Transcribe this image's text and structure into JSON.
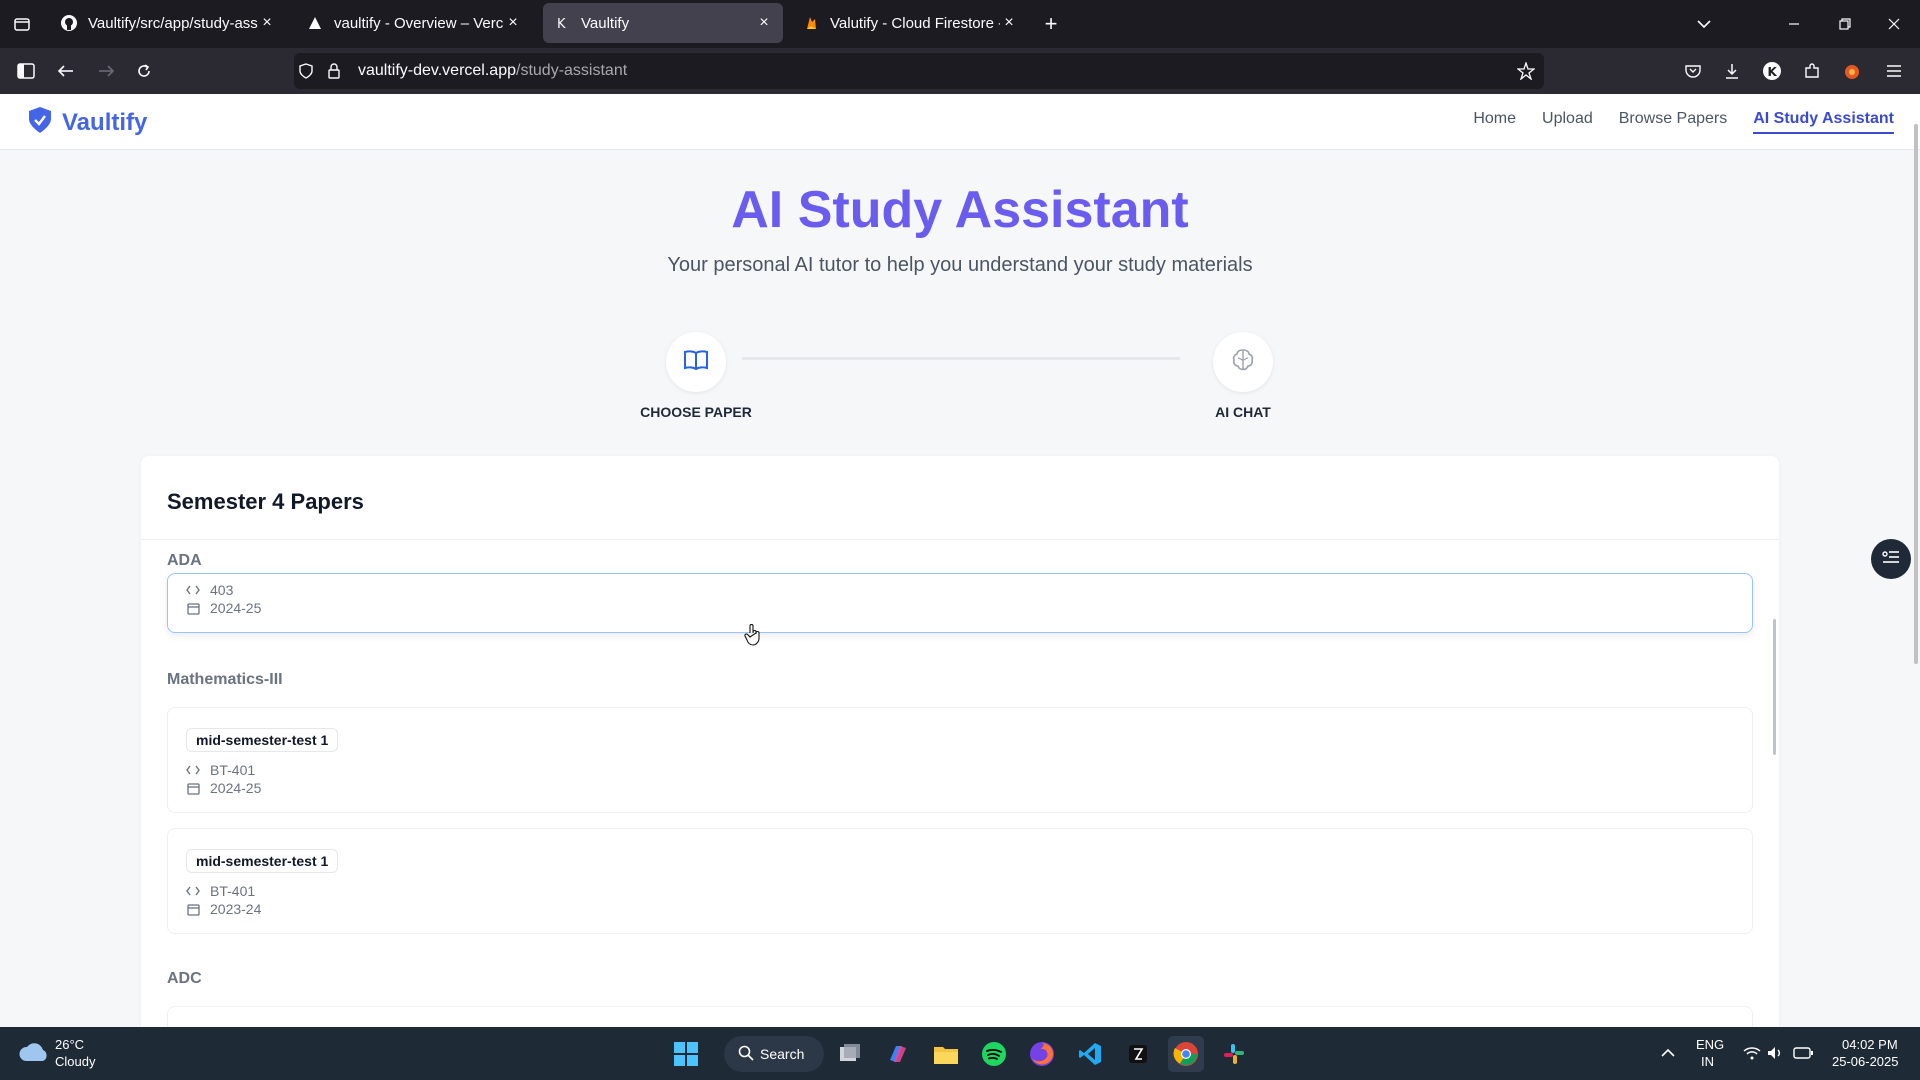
{
  "browser": {
    "tabs": [
      {
        "title": "Vaultify/src/app/study-assistant",
        "active": false
      },
      {
        "title": "vaultify - Overview – Vercel",
        "active": false
      },
      {
        "title": "Vaultify",
        "active": true
      },
      {
        "title": "Valutify - Cloud Firestore - Data",
        "active": false
      }
    ],
    "url_host": "vaultify-dev.vercel.app",
    "url_path": "/study-assistant"
  },
  "site": {
    "brand": "Vaultify",
    "nav": [
      "Home",
      "Upload",
      "Browse Papers",
      "AI Study Assistant"
    ],
    "active_nav": "AI Study Assistant"
  },
  "hero": {
    "title": "AI Study Assistant",
    "subtitle": "Your personal AI tutor to help you understand your study materials"
  },
  "steps": [
    {
      "label": "CHOOSE PAPER",
      "icon": "book-open-icon"
    },
    {
      "label": "AI CHAT",
      "icon": "brain-icon"
    }
  ],
  "panel": {
    "title": "Semester 4 Papers",
    "subjects": [
      {
        "name": "ADA",
        "papers": [
          {
            "exam": "",
            "code": "403",
            "year": "2024-25"
          }
        ]
      },
      {
        "name": "Mathematics-III",
        "papers": [
          {
            "exam": "mid-semester-test 1",
            "code": "BT-401",
            "year": "2024-25"
          },
          {
            "exam": "mid-semester-test 1",
            "code": "BT-401",
            "year": "2023-24"
          }
        ]
      },
      {
        "name": "ADC",
        "papers": []
      }
    ]
  },
  "taskbar": {
    "weather_temp": "26°C",
    "weather_desc": "Cloudy",
    "search_label": "Search",
    "lang_1": "ENG",
    "lang_2": "IN",
    "time": "04:02 PM",
    "date": "25-06-2025"
  },
  "colors": {
    "brand": "#4466e6",
    "hero_title": "#6b5cf0",
    "active_nav": "#3b4bcf",
    "highlight_border": "#93c5fd"
  }
}
